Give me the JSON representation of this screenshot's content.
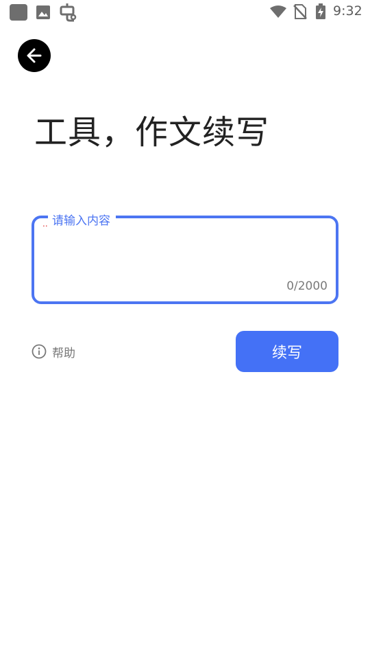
{
  "status_bar": {
    "time": "9:32",
    "icons": [
      "app-square-icon",
      "image-icon",
      "bug-icon",
      "wifi-icon",
      "no-sim-icon",
      "battery-charging-icon"
    ]
  },
  "header": {
    "back_icon": "arrow-left-icon",
    "title": "工具，作文续写"
  },
  "input": {
    "label": "请输入内容",
    "required_mark": "..",
    "value": "",
    "counter": "0/2000"
  },
  "actions": {
    "help_icon": "info-icon",
    "help_label": "帮助",
    "continue_label": "续写"
  },
  "colors": {
    "accent": "#4c75f2",
    "button": "#4471f6",
    "title": "#222222",
    "muted": "#777777"
  }
}
